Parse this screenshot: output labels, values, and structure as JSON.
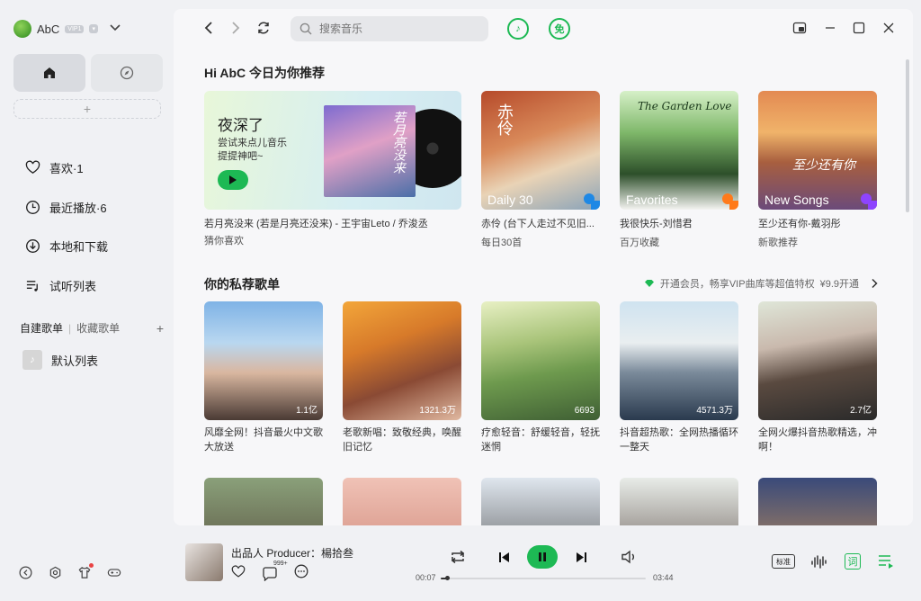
{
  "user": {
    "name": "AbC",
    "vip_badge": "VIP1"
  },
  "sidebar": {
    "menu": [
      {
        "label": "喜欢·1",
        "icon": "heart-icon"
      },
      {
        "label": "最近播放·6",
        "icon": "clock-icon"
      },
      {
        "label": "本地和下载",
        "icon": "download-icon"
      },
      {
        "label": "试听列表",
        "icon": "playlist-icon"
      }
    ],
    "playlist_tabs": {
      "created": "自建歌单",
      "collected": "收藏歌单"
    },
    "default_playlist": "默认列表"
  },
  "search": {
    "placeholder": "搜索音乐"
  },
  "topbar": {
    "free_label": "免"
  },
  "recommend": {
    "title": "Hi AbC 今日为你推荐",
    "banner": {
      "title": "夜深了",
      "subtitle": "尝试来点儿音乐提提神吧~",
      "cover_text": "若月亮没来",
      "caption": "若月亮没来 (若是月亮还没来) - 王宇宙Leto / 乔浚丞",
      "caption2": "猜你喜欢"
    },
    "cards": [
      {
        "overlay": "Daily 30",
        "line1": "赤伶 (台下人走过不见旧...",
        "line2": "每日30首",
        "cover_text": "赤伶"
      },
      {
        "overlay": "Favorites",
        "line1": "我很快乐-刘惜君",
        "line2": "百万收藏",
        "cover_text": "The Garden Love"
      },
      {
        "overlay": "New Songs",
        "line1": "至少还有你-戴羽彤",
        "line2": "新歌推荐",
        "cover_text": "至少还有你"
      }
    ]
  },
  "private": {
    "title": "你的私荐歌单",
    "vip_text": "开通会员，畅享VIP曲库等超值特权",
    "vip_price": "¥9.9开通",
    "cards": [
      {
        "count": "1.1亿",
        "desc": "风靡全网！抖音最火中文歌大放送"
      },
      {
        "count": "1321.3万",
        "desc": "老歌新唱：致敬经典，唤醒旧记忆"
      },
      {
        "count": "6693",
        "desc": "疗愈轻音：舒缓轻音，轻抚迷惘"
      },
      {
        "count": "4571.3万",
        "desc": "抖音超热歌：全网热播循环一整天"
      },
      {
        "count": "2.7亿",
        "desc": "全网火爆抖音热歌精选，冲啊！"
      }
    ]
  },
  "player": {
    "title": "出品人 Producer：楊拾叁",
    "comment_count": "999+",
    "current_time": "00:07",
    "total_time": "03:44",
    "progress": 0.031,
    "quality_label": "标准",
    "lyric_label": "词"
  },
  "colors": {
    "accent": "#1db954",
    "background": "#f0f1f4"
  }
}
